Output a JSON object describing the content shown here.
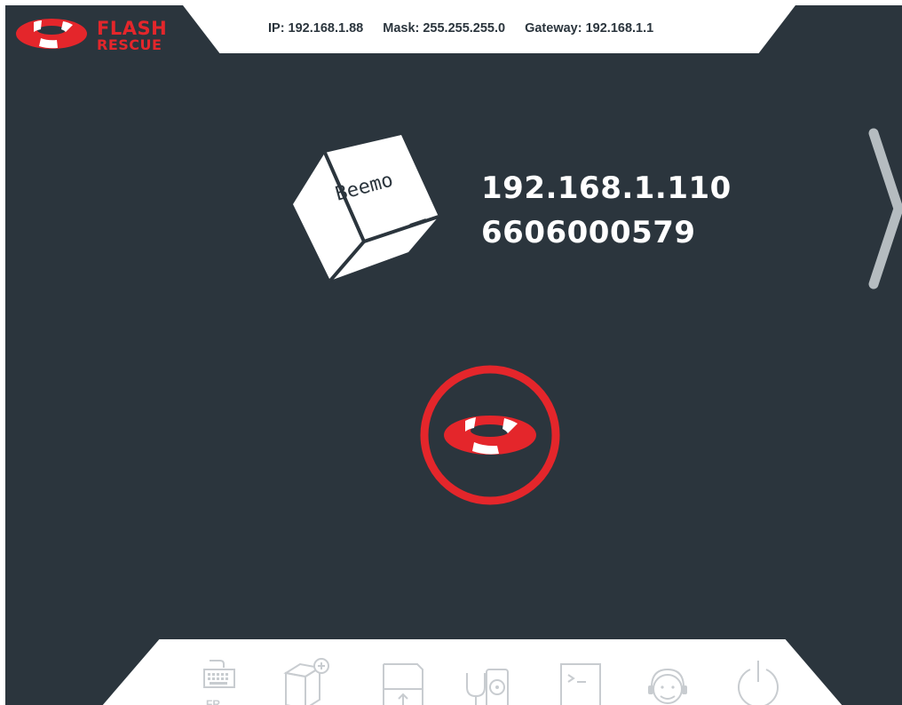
{
  "app": {
    "logo_line1": "FLASH",
    "logo_line2": "RESCUE"
  },
  "network": {
    "ip": "IP: 192.168.1.88",
    "mask": "Mask: 255.255.255.0",
    "gateway": "Gateway: 192.168.1.1"
  },
  "device": {
    "brand": "Beemo",
    "ip": "192.168.1.110",
    "serial": "6606000579"
  },
  "toolbar": {
    "keyboard_lang": "FR",
    "tools": [
      "keyboard-icon",
      "add-device-icon",
      "upload-icon",
      "disk-diagnostic-icon",
      "terminal-icon",
      "support-icon",
      "power-icon"
    ]
  },
  "colors": {
    "background": "#2b353d",
    "brand_red": "#e4262b",
    "icon_gray": "#c8ccd0",
    "arrow_gray": "#b5bcc0"
  }
}
